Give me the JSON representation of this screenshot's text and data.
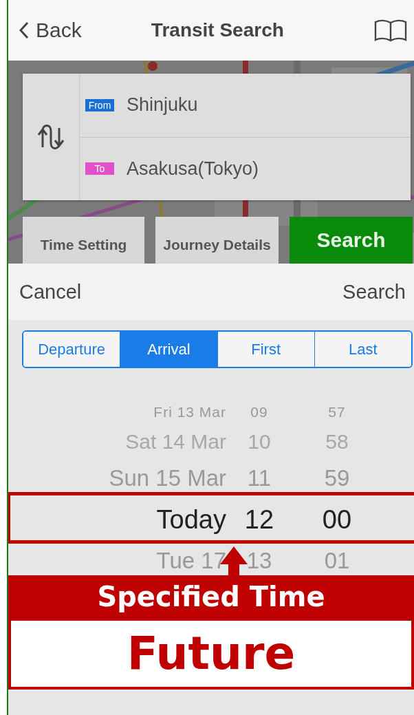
{
  "nav": {
    "back": "Back",
    "title": "Transit Search"
  },
  "route": {
    "from": {
      "tag": "From",
      "station": "Shinjuku"
    },
    "to": {
      "tag": "To",
      "station": "Asakusa(Tokyo)"
    }
  },
  "actions": [
    {
      "label": "Time Setting",
      "kind": "plain"
    },
    {
      "label": "Journey Details",
      "kind": "plain"
    },
    {
      "label": "Search",
      "kind": "primary"
    }
  ],
  "sheet": {
    "cancel": "Cancel",
    "confirm": "Search"
  },
  "modes": [
    {
      "label": "Departure",
      "selected": false
    },
    {
      "label": "Arrival",
      "selected": true
    },
    {
      "label": "First",
      "selected": false
    },
    {
      "label": "Last",
      "selected": false
    }
  ],
  "picker_rows": [
    {
      "day": "Fri 13 Mar",
      "hour": "09",
      "minute": "57",
      "selected": false
    },
    {
      "day": "Sat 14 Mar",
      "hour": "10",
      "minute": "58",
      "selected": false
    },
    {
      "day": "Sun 15 Mar",
      "hour": "11",
      "minute": "59",
      "selected": false
    },
    {
      "day": "Today",
      "hour": "12",
      "minute": "00",
      "selected": true
    },
    {
      "day": "Tue 17",
      "hour": "13",
      "minute": "01",
      "selected": false
    }
  ],
  "callout": {
    "banner": "Specified Time",
    "label": "Future"
  }
}
